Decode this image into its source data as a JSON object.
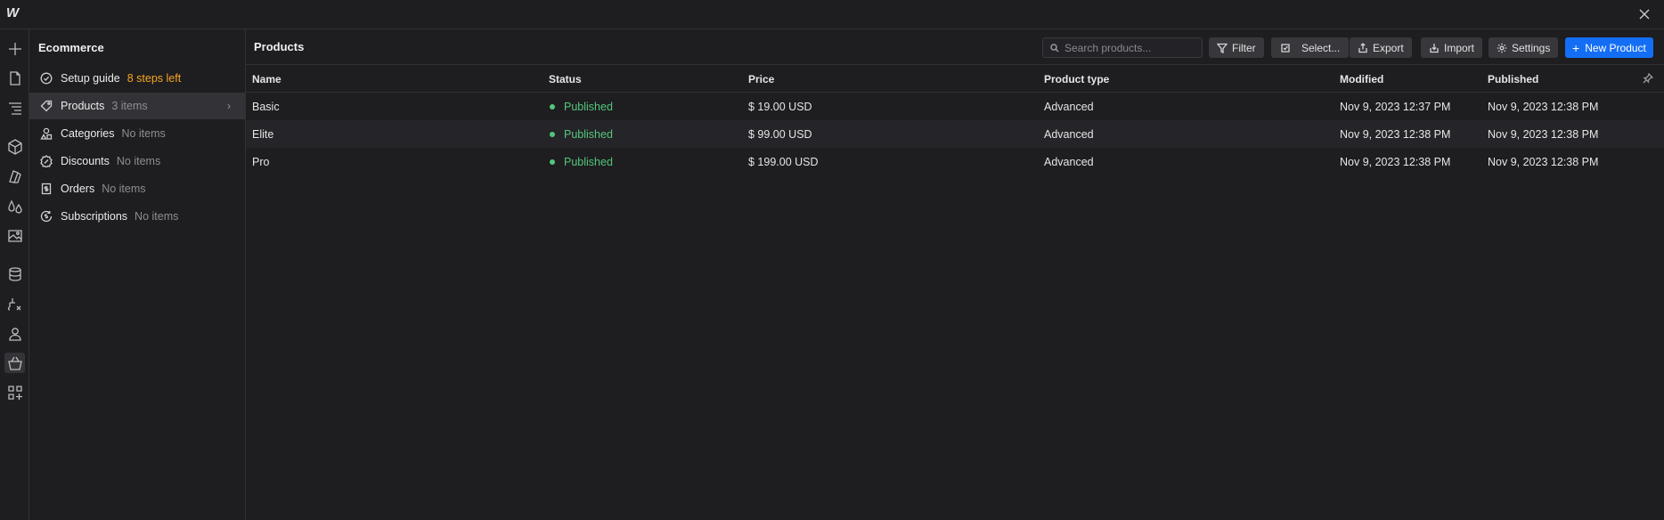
{
  "app": {
    "logo_text": "W"
  },
  "sidebar": {
    "title": "Ecommerce",
    "items": [
      {
        "label": "Setup guide",
        "sub": "8 steps left",
        "icon": "check-circle-icon"
      },
      {
        "label": "Products",
        "sub": "3 items",
        "icon": "tag-icon"
      },
      {
        "label": "Categories",
        "sub": "No items",
        "icon": "shapes-icon"
      },
      {
        "label": "Discounts",
        "sub": "No items",
        "icon": "discount-badge-icon"
      },
      {
        "label": "Orders",
        "sub": "No items",
        "icon": "receipt-icon"
      },
      {
        "label": "Subscriptions",
        "sub": "No items",
        "icon": "subscription-icon"
      }
    ]
  },
  "header": {
    "title": "Products",
    "search_placeholder": "Search products...",
    "filter_label": "Filter",
    "select_label": "Select...",
    "export_label": "Export",
    "import_label": "Import",
    "settings_label": "Settings",
    "new_product_label": "New Product"
  },
  "table": {
    "columns": [
      "Name",
      "Status",
      "Price",
      "Product type",
      "Modified",
      "Published"
    ],
    "rows": [
      {
        "name": "Basic",
        "status": "Published",
        "price": "$ 19.00 USD",
        "type": "Advanced",
        "modified": "Nov 9, 2023 12:37 PM",
        "published": "Nov 9, 2023 12:38 PM"
      },
      {
        "name": "Elite",
        "status": "Published",
        "price": "$ 99.00 USD",
        "type": "Advanced",
        "modified": "Nov 9, 2023 12:38 PM",
        "published": "Nov 9, 2023 12:38 PM"
      },
      {
        "name": "Pro",
        "status": "Published",
        "price": "$ 199.00 USD",
        "type": "Advanced",
        "modified": "Nov 9, 2023 12:38 PM",
        "published": "Nov 9, 2023 12:38 PM"
      }
    ]
  },
  "colors": {
    "accent": "#146ef5",
    "published": "#53c77c",
    "steps_left": "#f5a623",
    "background": "#1e1d20"
  }
}
